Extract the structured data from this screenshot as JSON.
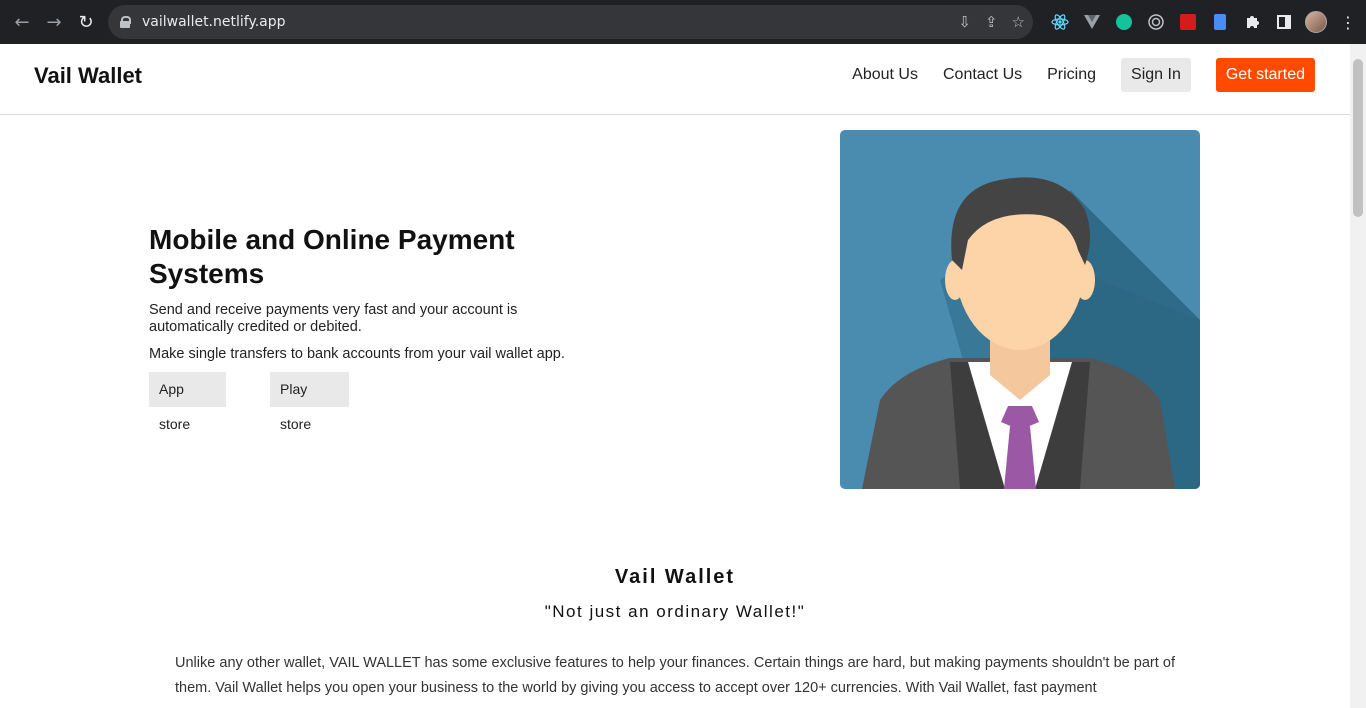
{
  "browser": {
    "url": "vailwallet.netlify.app",
    "back_icon": "←",
    "forward_icon": "→",
    "reload_icon": "↻",
    "omnibox_icons": [
      "⇩",
      "⇪",
      "☆"
    ],
    "extension_icons": [
      "react-icon",
      "vue-icon",
      "grammarly-icon",
      "target-icon",
      "pdf-icon",
      "doc-icon",
      "puzzle-icon",
      "sidepanel-icon",
      "profile-avatar",
      "menu-icon"
    ]
  },
  "nav": {
    "brand": "Vail Wallet",
    "links": [
      "About Us",
      "Contact Us",
      "Pricing"
    ],
    "signin": "Sign In",
    "get_started": "Get started"
  },
  "hero": {
    "title": "Mobile and Online Payment Systems",
    "text1": "Send and receive payments very fast and your account is automatically credited or debited.",
    "text2": "Make single transfers to bank accounts from your vail wallet app.",
    "app_store": "App store",
    "play_store": "Play store"
  },
  "section": {
    "title": "Vail Wallet",
    "subtitle": "\"Not just an ordinary Wallet!\"",
    "body": "Unlike any other wallet, VAIL WALLET has some exclusive features to help your finances. Certain things are hard, but making payments shouldn't be part of them. Vail Wallet helps you open your business to the world by giving you access to accept over 120+ currencies. With Vail Wallet, fast payment"
  },
  "colors": {
    "accent": "#ff4a00",
    "chrome_bg": "#202124",
    "hero_bg": "#4a8bb0"
  }
}
